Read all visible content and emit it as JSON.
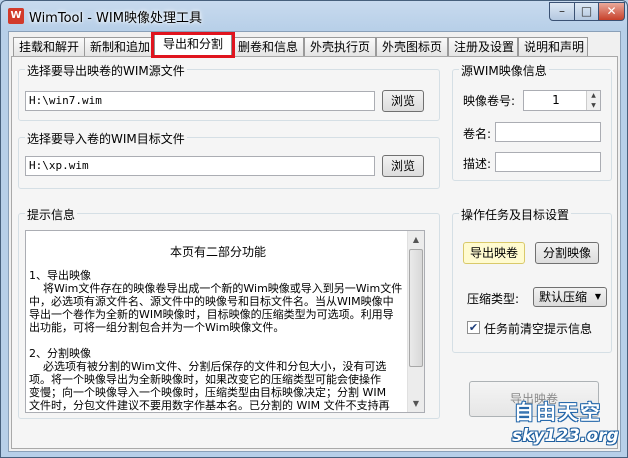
{
  "window": {
    "title": "WimTool - WIM映像处理工具",
    "app_icon_glyph": "W",
    "controls": {
      "minimize": "–",
      "maximize": "□",
      "close": "✕"
    }
  },
  "tabs": [
    {
      "label": "挂载和解开"
    },
    {
      "label": "新制和追加"
    },
    {
      "label": "导出和分割",
      "active": true
    },
    {
      "label": "删卷和信息"
    },
    {
      "label": "外壳执行页"
    },
    {
      "label": "外壳图标页"
    },
    {
      "label": "注册及设置"
    },
    {
      "label": "说明和声明"
    }
  ],
  "source_group": {
    "title": "选择要导出映卷的WIM源文件",
    "path_value": "H:\\win7.wim",
    "browse_label": "浏览"
  },
  "target_group": {
    "title": "选择要导入卷的WIM目标文件",
    "path_value": "H:\\xp.wim",
    "browse_label": "浏览"
  },
  "info_group": {
    "title": "源WIM映像信息",
    "volume_label": "映像卷号:",
    "volume_value": "1",
    "name_label": "卷名:",
    "name_value": "",
    "desc_label": "描述:",
    "desc_value": ""
  },
  "hint_group": {
    "title": "提示信息",
    "heading": "本页有二部分功能",
    "lines": [
      "1、导出映像",
      "    将Wim文件存在的映像卷导出成一个新的Wim映像或导入到另一Wim文件",
      "中，必选项有源文件名、源文件中的映像号和目标文件名。当从WIM映像中",
      "导出一个卷作为全新的WIM映像时，目标映像的压缩类型为可选项。利用导",
      "出功能，可将一组分割包合并为一个Wim映像文件。",
      "",
      "2、分割映像",
      "    必选项有被分割的Wim文件、分割后保存的文件和分包大小，没有可选",
      "项。将一个映像导出为全新映像时，如果改变它的压缩类型可能会使操作",
      "变慢；向一个映像导入一个映像时，压缩类型由目标映像决定；分割 WIM",
      "文件时，分包文件建议不要用数字作基本名。已分割的 WIM 文件不支持再"
    ]
  },
  "task_group": {
    "title": "操作任务及目标设置",
    "export_button": "导出映卷",
    "split_button": "分割映像",
    "compress_label": "压缩类型:",
    "compress_value": "默认压缩",
    "clear_checkbox_label": "任务前清空提示信息",
    "clear_checked": true,
    "run_button": "导出映卷"
  },
  "watermark": {
    "line1": "自由天空",
    "line2": "sky123.org"
  }
}
